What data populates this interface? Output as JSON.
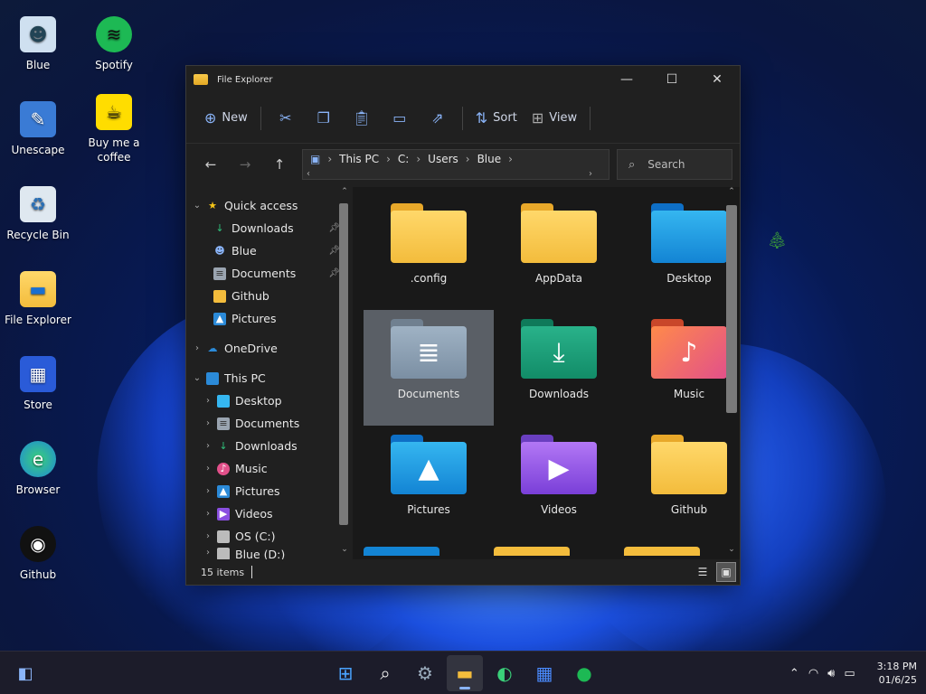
{
  "colors": {
    "accent": "#8ab4f8",
    "window_bg": "#202020",
    "selected_tile": "#5a5f66",
    "taskbar_bg": "#1c1c2a"
  },
  "desktop": {
    "icons": [
      {
        "label": "Blue",
        "icon": "user-icon"
      },
      {
        "label": "Spotify",
        "icon": "spotify-icon"
      },
      {
        "label": "Unescape",
        "icon": "unescape-icon"
      },
      {
        "label": "Buy me a coffee",
        "icon": "coffee-icon"
      },
      {
        "label": "Recycle Bin",
        "icon": "recycle-bin-icon"
      },
      {
        "label": "File Explorer",
        "icon": "folder-icon"
      },
      {
        "label": "Store",
        "icon": "store-icon"
      },
      {
        "label": "Browser",
        "icon": "edge-icon"
      },
      {
        "label": "Github",
        "icon": "github-icon"
      }
    ]
  },
  "window": {
    "title": "File Explorer",
    "controls": {
      "minimize": "—",
      "maximize": "☐",
      "close": "✕"
    }
  },
  "toolbar": {
    "new_label": "New",
    "sort_label": "Sort",
    "view_label": "View"
  },
  "address": {
    "segments": [
      "This PC",
      "C:",
      "Users",
      "Blue"
    ]
  },
  "search": {
    "placeholder": "Search"
  },
  "nav": {
    "quick_access": {
      "label": "Quick access",
      "items": [
        {
          "label": "Downloads",
          "icon": "download-icon",
          "pinned": true
        },
        {
          "label": "Blue",
          "icon": "user-icon",
          "pinned": true
        },
        {
          "label": "Documents",
          "icon": "document-icon",
          "pinned": true
        },
        {
          "label": "Github",
          "icon": "folder-icon",
          "pinned": false
        },
        {
          "label": "Pictures",
          "icon": "picture-icon",
          "pinned": false
        }
      ]
    },
    "onedrive": {
      "label": "OneDrive"
    },
    "this_pc": {
      "label": "This PC",
      "items": [
        {
          "label": "Desktop",
          "icon": "desktop-icon"
        },
        {
          "label": "Documents",
          "icon": "document-icon"
        },
        {
          "label": "Downloads",
          "icon": "download-icon"
        },
        {
          "label": "Music",
          "icon": "music-icon"
        },
        {
          "label": "Pictures",
          "icon": "picture-icon"
        },
        {
          "label": "Videos",
          "icon": "video-icon"
        },
        {
          "label": "OS (C:)",
          "icon": "drive-icon"
        },
        {
          "label": "Blue (D:)",
          "icon": "drive-icon"
        }
      ]
    }
  },
  "files": [
    {
      "label": ".config",
      "icon": "folder-icon",
      "selected": false
    },
    {
      "label": "AppData",
      "icon": "folder-icon",
      "selected": false
    },
    {
      "label": "Desktop",
      "icon": "desktop-folder-icon",
      "selected": false
    },
    {
      "label": "Documents",
      "icon": "documents-folder-icon",
      "selected": true
    },
    {
      "label": "Downloads",
      "icon": "downloads-folder-icon",
      "selected": false
    },
    {
      "label": "Music",
      "icon": "music-folder-icon",
      "selected": false
    },
    {
      "label": "Pictures",
      "icon": "pictures-folder-icon",
      "selected": false
    },
    {
      "label": "Videos",
      "icon": "videos-folder-icon",
      "selected": false
    },
    {
      "label": "Github",
      "icon": "folder-icon",
      "selected": false
    }
  ],
  "status": {
    "count": "15 items"
  },
  "taskbar": {
    "apps": [
      {
        "name": "start",
        "icon": "windows-start-icon",
        "active": false
      },
      {
        "name": "search",
        "icon": "search-icon",
        "active": false
      },
      {
        "name": "settings",
        "icon": "gear-icon",
        "active": false
      },
      {
        "name": "file-explorer",
        "icon": "folder-icon",
        "active": true
      },
      {
        "name": "browser",
        "icon": "edge-icon",
        "active": false
      },
      {
        "name": "store",
        "icon": "store-icon",
        "active": false
      },
      {
        "name": "spotify",
        "icon": "spotify-icon",
        "active": false
      }
    ],
    "clock": {
      "time": "3:18 PM",
      "date": "01/6/25"
    }
  }
}
